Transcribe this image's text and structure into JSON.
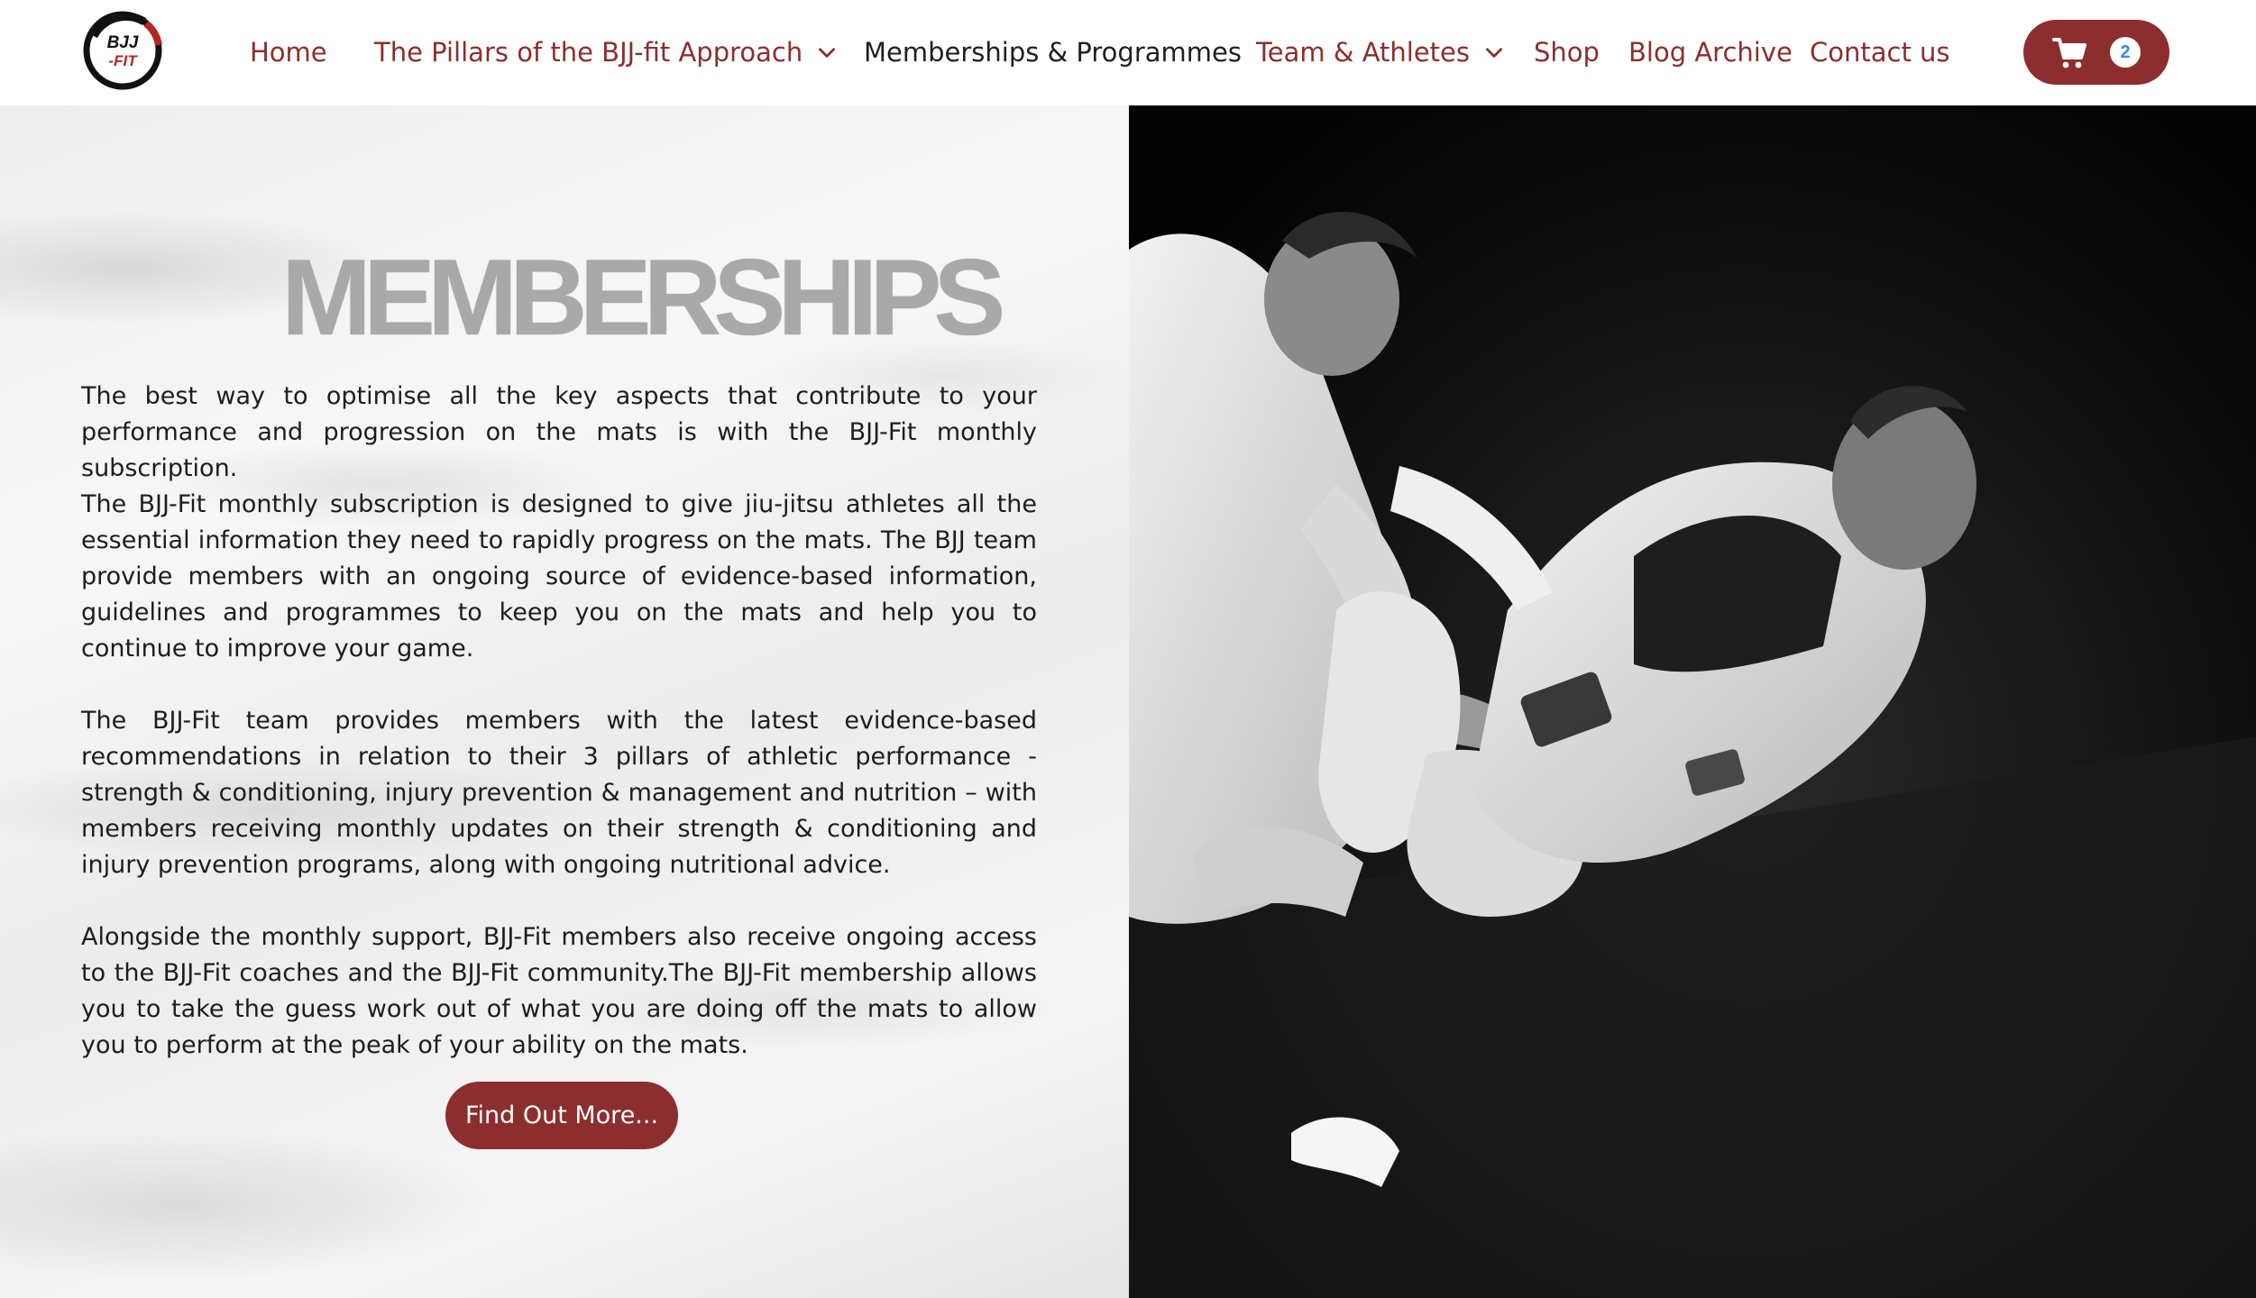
{
  "brand": {
    "logo_text": "BJJ-FIT",
    "accent_color": "#8c2e2e"
  },
  "nav": {
    "items": [
      {
        "label": "Home"
      },
      {
        "label": "The Pillars of the BJJ-fit Approach",
        "has_dropdown": true
      },
      {
        "label": "Memberships & Programmes",
        "current": true
      },
      {
        "label": "Team & Athletes",
        "has_dropdown": true
      },
      {
        "label": "Shop"
      },
      {
        "label": "Blog Archive"
      },
      {
        "label": "Contact us"
      }
    ],
    "cart": {
      "icon": "cart-icon",
      "count": "2"
    }
  },
  "main": {
    "title": "MEMBERSHIPS",
    "paragraphs": [
      "The best way to optimise all the key aspects that contribute to your performance and progression on the mats is with the BJJ-Fit monthly subscription.",
      "The BJJ-Fit monthly subscription is designed to give jiu-jitsu athletes all the essential information they need to rapidly progress on the mats. The BJJ team provide members with an ongoing source of evidence-based information, guidelines and programmes to keep you on the mats and help you to continue to improve your game.",
      "The BJJ-Fit team provides members with the latest evidence-based recommendations in relation to their 3 pillars of athletic performance - strength & conditioning, injury prevention & management and nutrition – with members receiving monthly updates on their strength & conditioning and injury prevention programs, along with ongoing nutritional advice.",
      "Alongside the monthly support, BJJ-Fit members also receive ongoing access to the BJJ-Fit coaches and the BJJ-Fit community.The BJJ-Fit membership allows you to take the guess work out of what you are doing off the mats to allow you to perform at the peak of your ability on the mats."
    ],
    "cta_label": "Find Out More..."
  }
}
